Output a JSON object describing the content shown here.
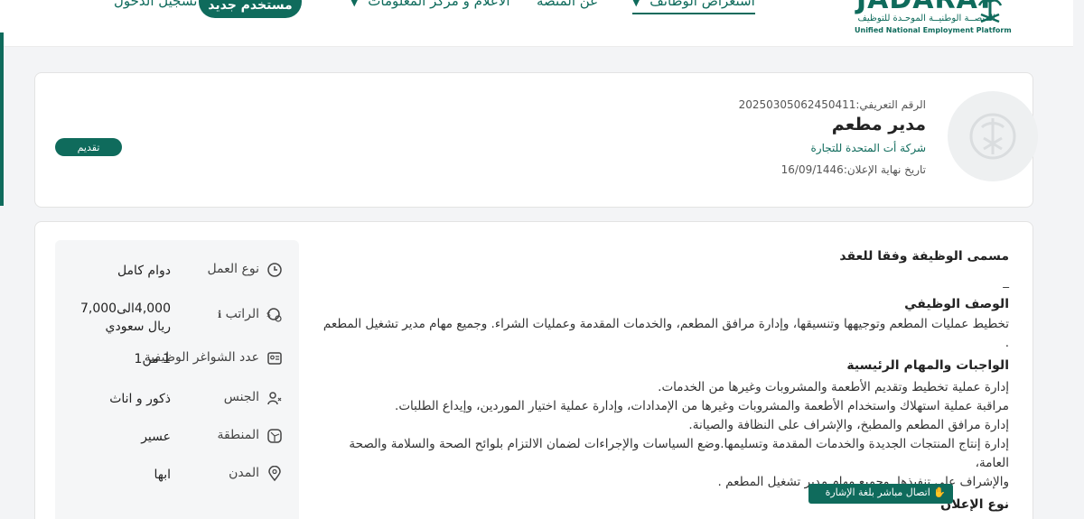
{
  "header": {
    "logo_word": "JADARAT",
    "logo_ar": "المنصــة الوطنيــة الموحـدة للتوظيف",
    "logo_en": "Unified National Employment Platform",
    "nav": {
      "explore": "استعراض الوظائف",
      "about": "عن المنصة",
      "media": "الأعلام و مركز المعلومات"
    },
    "register_label": "مستخدم جديد",
    "login_label": "تسجيل الدخول"
  },
  "job": {
    "ref_label": "الرقم التعريفي:",
    "ref_value": "20250305062450411",
    "title": "مدير مطعم",
    "company": "شركة أت المتحدة للتجارة",
    "deadline_label": "تاريخ نهاية الإعلان:",
    "deadline_value": "16/09/1446",
    "apply_label": "تقديم"
  },
  "facts": [
    {
      "icon": "clock-icon",
      "label": "نوع العمل",
      "value": "دوام كامل"
    },
    {
      "icon": "money-icon",
      "label": "الراتب",
      "value": "4,000الى7,000 ريال سعودي"
    },
    {
      "icon": "id-card-icon",
      "label": "عدد الشواغر الوظيفية",
      "value": "1 من1"
    },
    {
      "icon": "gender-icon",
      "label": "الجنس",
      "value": "ذكور و اناث"
    },
    {
      "icon": "region-icon",
      "label": "المنطقة",
      "value": "عسير"
    },
    {
      "icon": "location-pin-icon",
      "label": "المدن",
      "value": "ابها"
    }
  ],
  "description": {
    "contract_title_heading": "مسمى الوظيفة وفقا للعقد",
    "contract_title_value": "_",
    "job_desc_heading": "الوصف الوظيفي",
    "job_desc_text": "تخطيط عمليات المطعم وتوجيهها وتنسيقها، وإدارة مرافق المطعم، والخدمات المقدمة وعمليات الشراء. وجميع مهام مدير تشغيل المطعم .",
    "duties_heading": "الواجبات والمهام الرئيسية",
    "duties": [
      "إدارة عملية تخطيط وتقديم الأطعمة والمشروبات وغيرها من الخدمات.",
      "مراقبة عملية استهلاك واستخدام الأطعمة والمشروبات وغيرها من الإمدادات، وإدارة عملية اختيار الموردين، وإيداع الطلبات.",
      "إدارة مرافق المطعم والمطبخ، والإشراف على النظافة والصيانة.",
      "إدارة إنتاج المنتجات الجديدة والخدمات المقدمة وتسليمها.وضع السياسات والإجراءات لضمان الالتزام بلوائح الصحة والسلامة والصحة العامة،",
      "والإشراف على تنفيذها. وجميع مهام مدير تشغيل المطعم ."
    ],
    "ad_type_heading": "نوع الإعلان",
    "ad_type_badge": "اتصال مباشر بلغة الإشارة"
  }
}
